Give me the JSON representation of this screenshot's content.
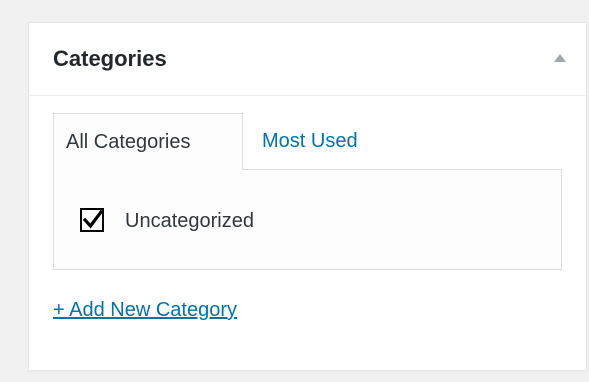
{
  "postbox": {
    "title": "Categories",
    "toggle_icon": "triangle-up-icon"
  },
  "tabs": [
    {
      "label": "All Categories",
      "active": true
    },
    {
      "label": "Most Used",
      "active": false
    }
  ],
  "categories": [
    {
      "label": "Uncategorized",
      "checked": true
    }
  ],
  "add_new_label": "+ Add New Category",
  "colors": {
    "link": "#0073aa",
    "text": "#32373c",
    "heading": "#23282d",
    "background": "#f1f1f1",
    "panel_border": "#dddddd"
  }
}
